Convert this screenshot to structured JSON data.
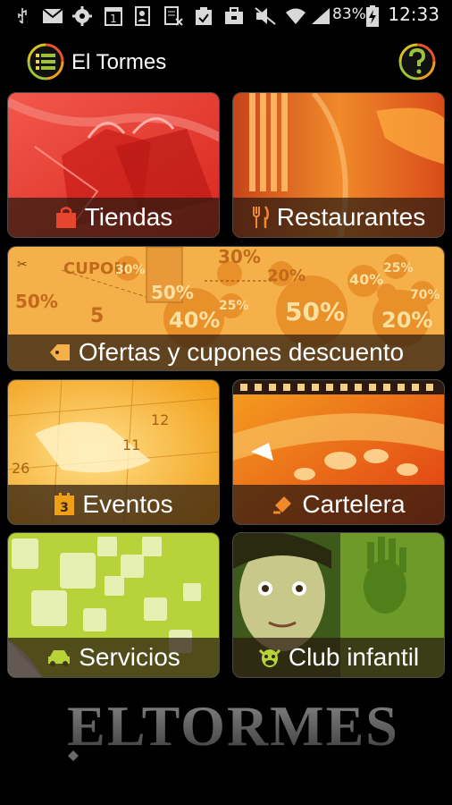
{
  "status_bar": {
    "battery": "83%",
    "time": "12:33",
    "calendar_day": "1"
  },
  "app_bar": {
    "title": "El Tormes",
    "menu_icon": "list-menu-icon",
    "help_icon": "help-icon"
  },
  "tiles": {
    "tiendas": {
      "label": "Tiendas",
      "icon": "shopping-bag-icon"
    },
    "restaurantes": {
      "label": "Restaurantes",
      "icon": "fork-knife-icon"
    },
    "ofertas": {
      "label": "Ofertas y cupones descuento",
      "icon": "tag-icon",
      "art": {
        "cupon": "CUPON",
        "p50": "50%",
        "p5off": "5",
        "p30": "30%",
        "p20": "20%",
        "p40": "40%",
        "p25": "25%",
        "p70": "70%"
      }
    },
    "eventos": {
      "label": "Eventos",
      "icon": "calendar-icon",
      "art": {
        "n12": "12",
        "n11": "11",
        "n26": "26",
        "cal": "3"
      }
    },
    "cartelera": {
      "label": "Cartelera",
      "icon": "film-clapper-icon"
    },
    "servicios": {
      "label": "Servicios",
      "icon": "car-icon"
    },
    "club": {
      "label": "Club infantil",
      "icon": "cow-icon"
    }
  },
  "brand_logo": "ELTORMES",
  "colors": {
    "tiendas": "#e0302a",
    "restaurantes": "#d9531a",
    "ofertas": "#f5a93a",
    "eventos": "#f2a018",
    "cartelera": "#e8561a",
    "servicios": "#b5d33a",
    "club": "#6e9a2a"
  }
}
